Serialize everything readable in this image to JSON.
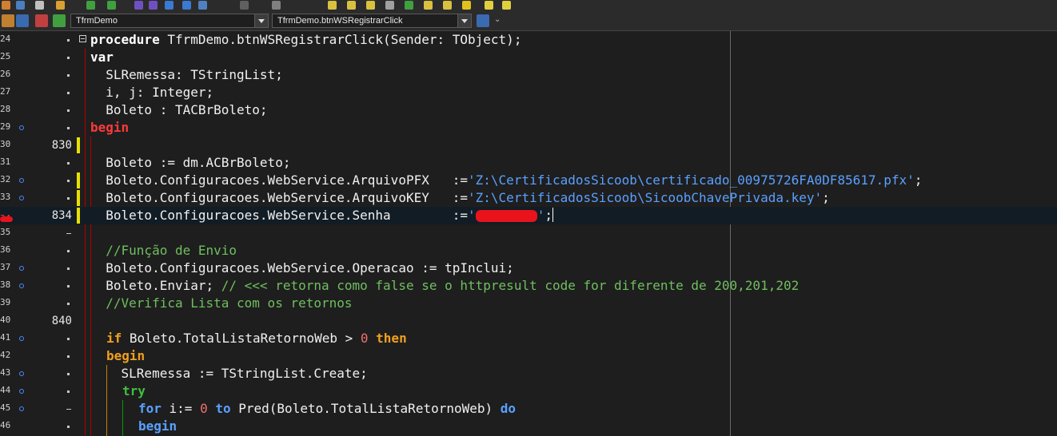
{
  "toolbar": {
    "unit_selector": "TfrmDemo",
    "method_selector": "TfrmDemo.btnWSRegistrarClick"
  },
  "editor": {
    "lines": [
      {
        "no": "24",
        "gutter": ""
      },
      {
        "no": "25",
        "gutter": ""
      },
      {
        "no": "26",
        "gutter": ""
      },
      {
        "no": "27",
        "gutter": ""
      },
      {
        "no": "28",
        "gutter": ""
      },
      {
        "no": "29",
        "gutter": ""
      },
      {
        "no": "30",
        "gutter": "830"
      },
      {
        "no": "31",
        "gutter": ""
      },
      {
        "no": "32",
        "gutter": ""
      },
      {
        "no": "33",
        "gutter": ""
      },
      {
        "no": "34",
        "gutter": "834"
      },
      {
        "no": "35",
        "gutter": ""
      },
      {
        "no": "36",
        "gutter": ""
      },
      {
        "no": "37",
        "gutter": ""
      },
      {
        "no": "38",
        "gutter": ""
      },
      {
        "no": "39",
        "gutter": ""
      },
      {
        "no": "40",
        "gutter": "840"
      },
      {
        "no": "41",
        "gutter": ""
      },
      {
        "no": "42",
        "gutter": ""
      },
      {
        "no": "43",
        "gutter": ""
      },
      {
        "no": "44",
        "gutter": ""
      },
      {
        "no": "45",
        "gutter": ""
      },
      {
        "no": "46",
        "gutter": ""
      }
    ],
    "code": {
      "l24a": "procedure",
      "l24b": " TfrmDemo.btnWSRegistrarClick(Sender: TObject);",
      "l25": "var",
      "l26": "  SLRemessa: TStringList;",
      "l27": "  i, j: Integer;",
      "l28": "  Boleto : TACBrBoleto;",
      "l29": "begin",
      "l31": "  Boleto := dm.ACBrBoleto;",
      "l32a": "  Boleto.Configuracoes.WebService.ArquivoPFX   :=",
      "l32b": "'Z:\\CertificadosSicoob\\certificado_00975726FA0DF85617.pfx'",
      "l32c": ";",
      "l33a": "  Boleto.Configuracoes.WebService.ArquivoKEY   :=",
      "l33b": "'Z:\\CertificadosSicoob\\SicoobChavePrivada.key'",
      "l33c": ";",
      "l34a": "  Boleto.Configuracoes.WebService.Senha        :=",
      "l34b": "'",
      "l34c": "        ",
      "l34d": "'",
      "l34e": ";",
      "l36": "  //Função de Envio",
      "l37": "  Boleto.Configuracoes.WebService.Operacao := tpInclui;",
      "l38a": "  Boleto.Enviar; ",
      "l38b": "// <<< retorna como false se o httpresult code for diferente de 200,201,202",
      "l39": "  //Verifica Lista com os retornos",
      "l41a": "if",
      "l41b": " Boleto.TotalListaRetornoWeb > ",
      "l41c": "0",
      "l41d": " then",
      "l42": "begin",
      "l43": "    SLRemessa := TStringList.Create;",
      "l44": "try",
      "l45a": "for",
      "l45b": " i:= ",
      "l45c": "0",
      "l45d": " to",
      "l45e": " Pred(Boleto.TotalListaRetornoWeb) ",
      "l45f": "do",
      "l46": "begin"
    }
  }
}
